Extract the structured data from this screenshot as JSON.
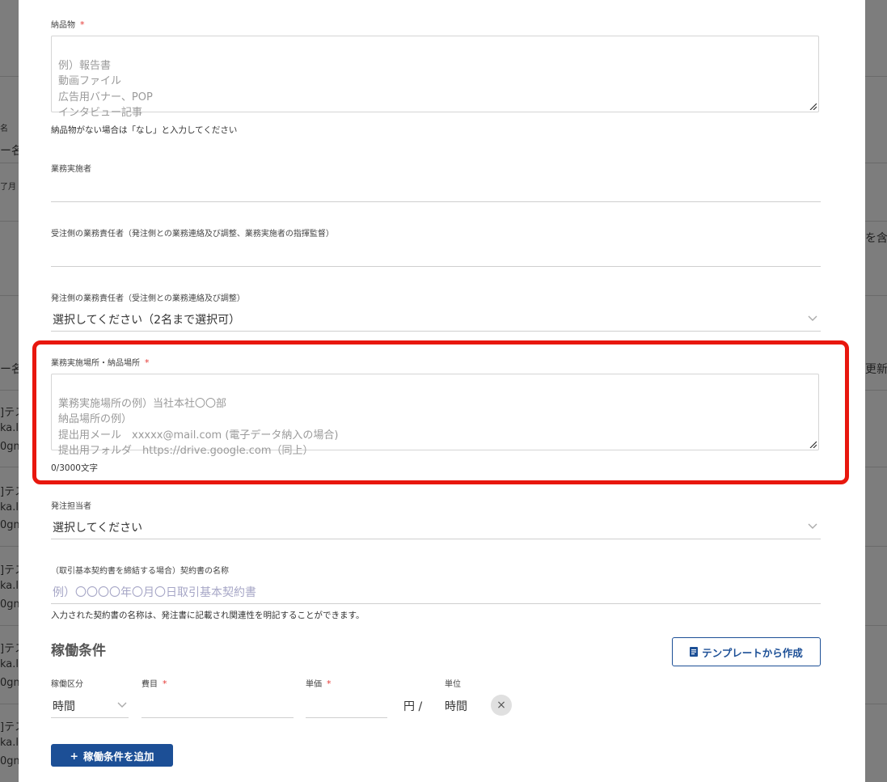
{
  "background": {
    "fragments": [
      "名",
      "ー名",
      "了月",
      "を含",
      "ー名",
      "更新",
      "]テス",
      "ka.la",
      "0gm",
      "]テス",
      "ka.la",
      "0gm",
      "]テス",
      "ka.la",
      "0gm",
      "]テス",
      "ka.la",
      "0gm",
      "]テス",
      "ka.la",
      "0gm"
    ]
  },
  "form": {
    "deliverables": {
      "label": "納品物",
      "required_mark": "*",
      "placeholder": "例）報告書\n動画ファイル\n広告用バナー、POP\nインタビュー記事",
      "hint": "納品物がない場合は「なし」と入力してください"
    },
    "executor": {
      "label": "業務実施者",
      "value": ""
    },
    "contractor_manager": {
      "label": "受注側の業務責任者（発注側との業務連絡及び調整、業務実施者の指揮監督）",
      "value": ""
    },
    "orderer_manager": {
      "label": "発注側の業務責任者（受注側との業務連絡及び調整）",
      "selected": "選択してください（2名まで選択可）"
    },
    "location": {
      "label": "業務実施場所・納品場所",
      "required_mark": "*",
      "placeholder": "業務実施場所の例）当社本社〇〇部\n納品場所の例）\n提出用メール　xxxxx@mail.com (電子データ納入の場合)\n提出用フォルダ　https://drive.google.com（同上）",
      "counter": "0/3000文字"
    },
    "order_staff": {
      "label": "発注担当者",
      "selected": "選択してください"
    },
    "contract_name": {
      "label": "（取引基本契約書を締結する場合）契約書の名称",
      "placeholder": "例）〇〇〇〇年〇月〇日取引基本契約書",
      "hint": "入力された契約書の名称は、発注書に記載され関連性を明記することができます。"
    }
  },
  "working_conditions": {
    "title": "稼働条件",
    "template_button": "テンプレートから作成",
    "columns": {
      "type": "稼働区分",
      "item": "費目",
      "unit_price": "単価",
      "unit": "単位",
      "required_mark": "*"
    },
    "row": {
      "type_value": "時間",
      "item_value": "",
      "price_value": "",
      "currency_suffix": "円 /",
      "unit_value": "時間",
      "remove_symbol": "×"
    },
    "add_button": "稼働条件を追加",
    "add_symbol": "+"
  },
  "colors": {
    "accent": "#1c4f96",
    "highlight": "#e8170e",
    "required": "#e53935"
  }
}
